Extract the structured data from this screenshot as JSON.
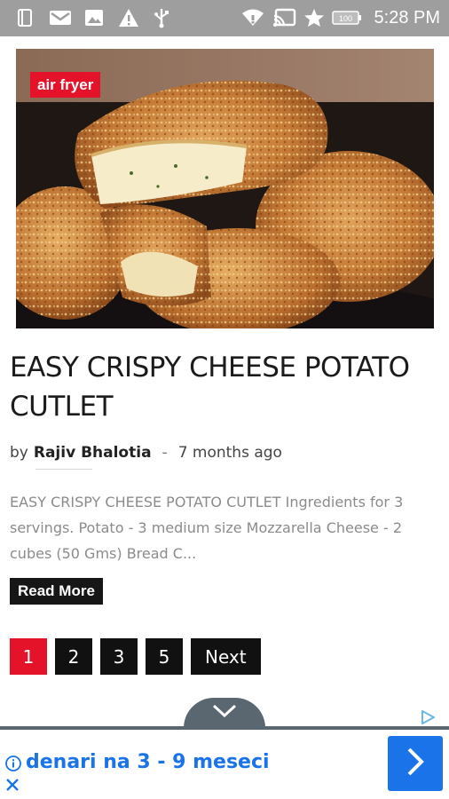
{
  "status_bar": {
    "time": "5:28 PM",
    "battery_level": "100",
    "icons": [
      "notes-icon",
      "gmail-icon",
      "image-icon",
      "warning-icon",
      "usb-icon",
      "wifi-icon",
      "cast-icon",
      "star-icon",
      "battery-icon"
    ]
  },
  "post": {
    "category_tag": "air fryer",
    "title": "EASY CRISPY CHEESE POTATO CUTLET",
    "by_label": "by",
    "author": "Rajiv Bhalotia",
    "separator": "-",
    "time_ago": "7 months ago",
    "excerpt": "EASY CRISPY CHEESE POTATO CUTLET Ingredients for 3 servings. Potato - 3 medium size Mozzarella Cheese - 2 cubes (50 Gms) Bread C...",
    "read_more_label": "Read More"
  },
  "pagination": {
    "pages": [
      "1",
      "2",
      "3",
      "5"
    ],
    "active_page": "1",
    "next_label": "Next"
  },
  "ad": {
    "text": "denari na 3 - 9 meseci",
    "accent_color": "#1a73e8"
  },
  "colors": {
    "status_bar": "#9e9e9e",
    "accent_red": "#e4132a",
    "dark_button": "#111111",
    "excerpt_text": "#8b8b8b"
  }
}
